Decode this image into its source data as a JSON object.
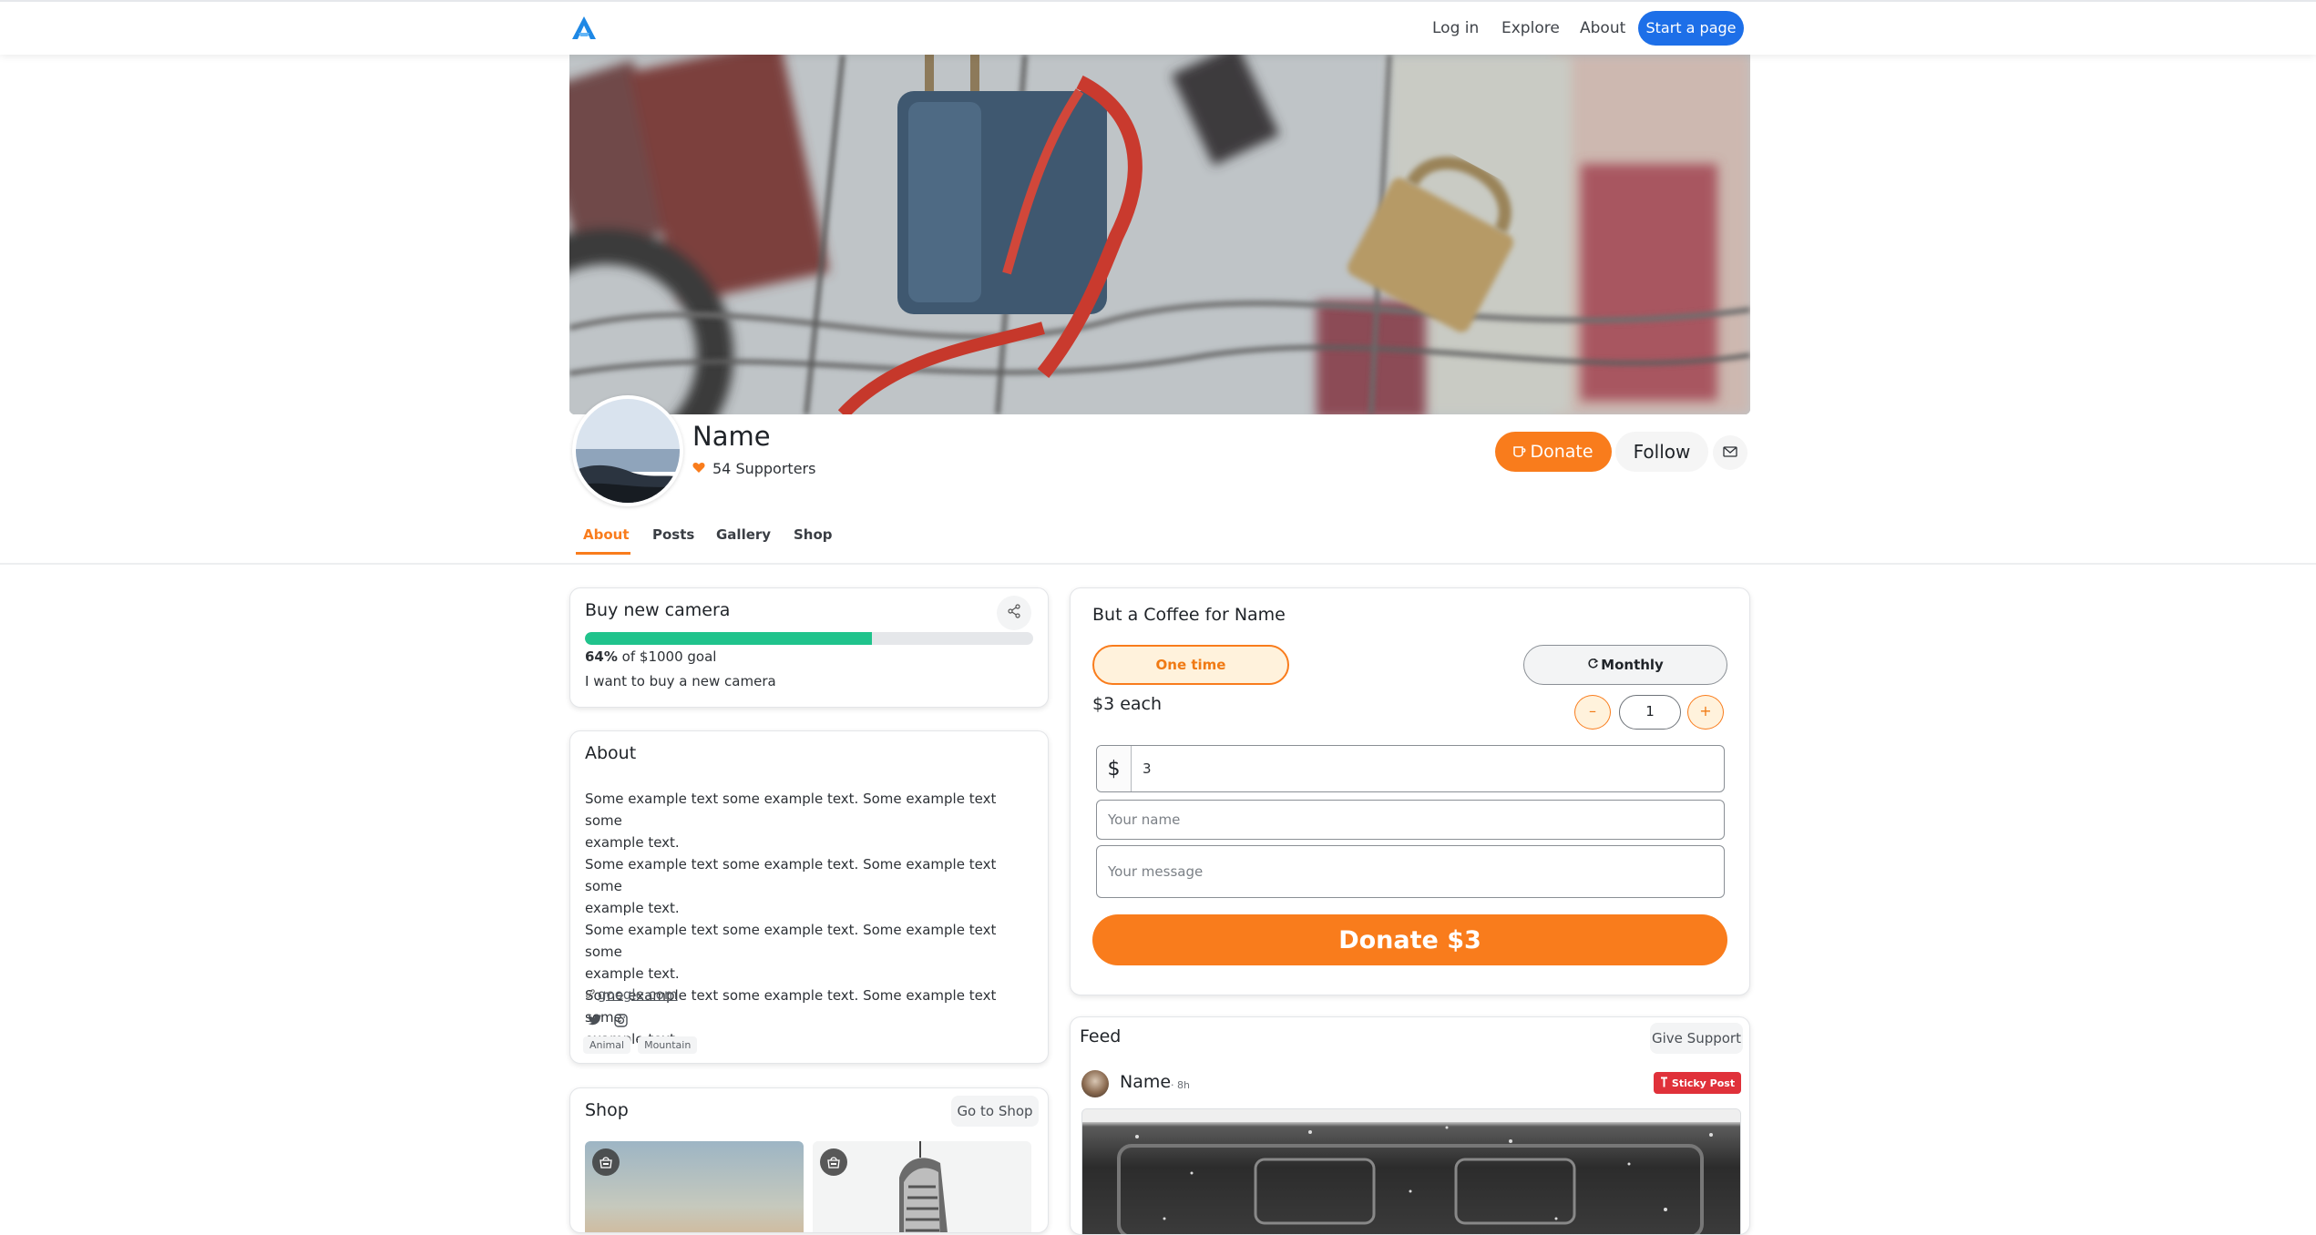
{
  "nav": {
    "links": [
      "Log in",
      "Explore",
      "About"
    ],
    "start_button": "Start a page"
  },
  "profile": {
    "name": "Name",
    "supporters": "54 Supporters",
    "donate_label": "Donate",
    "follow_label": "Follow"
  },
  "tabs": [
    "About",
    "Posts",
    "Gallery",
    "Shop"
  ],
  "active_tab": "About",
  "goal": {
    "title": "Buy new camera",
    "percent_value": 0.64,
    "percent": "64%",
    "goal_text": " of $1000 goal",
    "description": "I want to buy a new camera"
  },
  "about": {
    "title": "About",
    "paragraph_lines": [
      "Some example text some example text. Some example text some",
      "example text.",
      "Some example text some example text. Some example text some",
      "example text.",
      "Some example text some example text. Some example text some",
      "example text.",
      "Some example text some example text. Some example text some",
      "example text."
    ],
    "link": "google.com",
    "social_icons": [
      "twitter-icon",
      "instagram-icon"
    ],
    "tags": [
      "Animal",
      "Mountain"
    ]
  },
  "shop": {
    "title": "Shop",
    "go_to": "Go to Shop"
  },
  "coffee": {
    "title": "But a Coffee for Name",
    "one_time": "One time",
    "monthly": "Monthly",
    "each_label": "$3 each",
    "stepper_minus": "–",
    "quantity": "1",
    "stepper_plus": "+",
    "currency_prefix": "$",
    "amount": "3",
    "name_placeholder": "Your name",
    "message_placeholder": "Your message",
    "donate_button": "Donate $3"
  },
  "feed": {
    "title": "Feed",
    "give_support": "Give Support",
    "post_author": "Name",
    "post_time": "· 8h",
    "sticky_label": "Sticky Post"
  },
  "colors": {
    "accent": "#f97c1c",
    "primary_blue": "#1d6fe8",
    "progress": "#20c38c",
    "sticky": "#e0313a"
  }
}
